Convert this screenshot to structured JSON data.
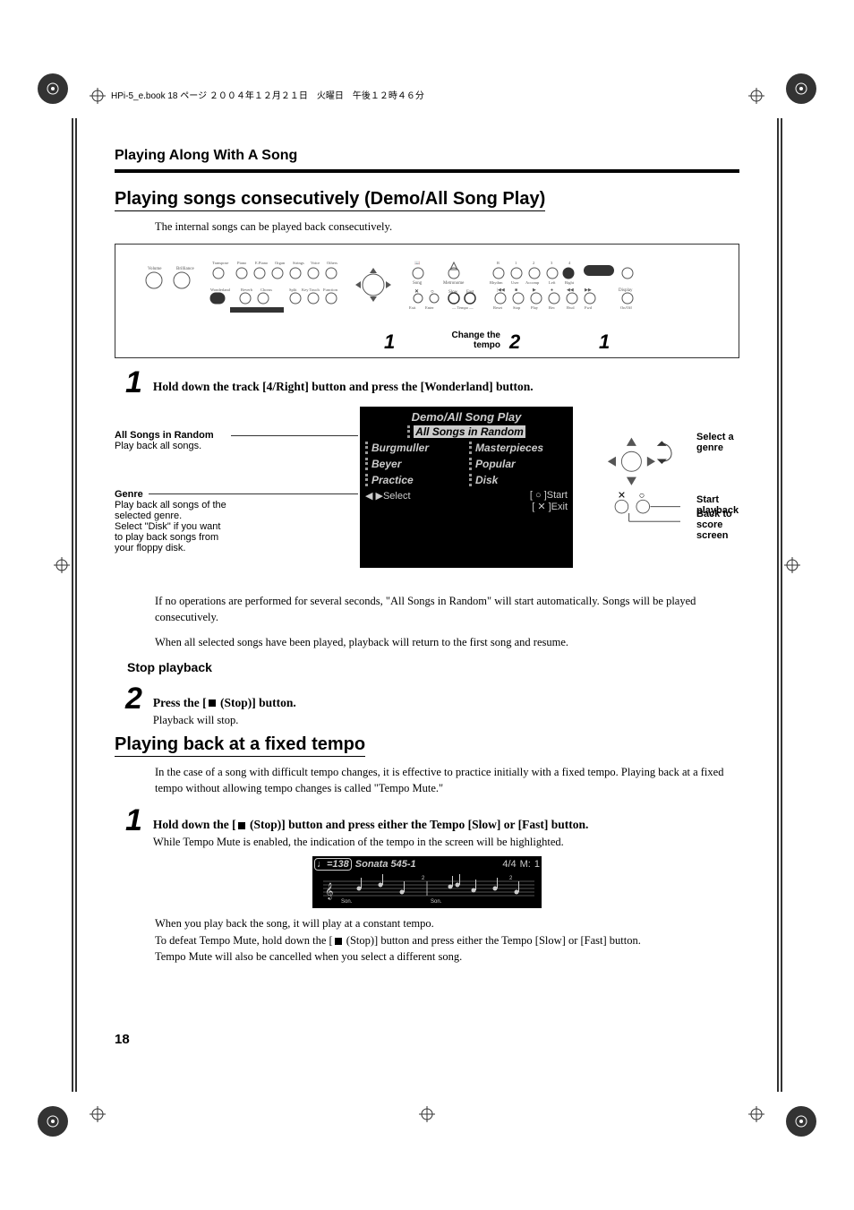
{
  "header_note": "HPi-5_e.book  18 ページ  ２００４年１２月２１日　火曜日　午後１２時４６分",
  "section_top": "Playing Along With A Song",
  "h2a": "Playing songs consecutively (Demo/All Song Play)",
  "intro_a": "The internal songs can be played back consecutively.",
  "panel": {
    "change_tempo": "Change the tempo",
    "num2": "2",
    "num1a": "1",
    "num1b": "1"
  },
  "step1_num": "1",
  "step1_text": "Hold down the track [4/Right] button and press the [Wonderland] button.",
  "lcd": {
    "title": "Demo/All Song Play",
    "all_random": "All Songs in Random",
    "r1a": "Burgmuller",
    "r1b": "Masterpieces",
    "r2a": "Beyer",
    "r2b": "Popular",
    "r3a": "Practice",
    "r3b": "Disk",
    "bl": "◀ ▶Select",
    "br1": "[ ○ ]Start",
    "br2": "[ ✕ ]Exit"
  },
  "ann": {
    "all_title": "All Songs in Random",
    "all_body": "Play back all songs.",
    "genre_title": "Genre",
    "genre_body1": "Play back all songs of the selected genre.",
    "genre_body2": "Select \"Disk\" if you want to play back songs from your floppy disk.",
    "select_genre": "Select a genre",
    "start_pb": "Start playback",
    "back_score": "Back to score screen"
  },
  "post1a": "If no operations are performed for several seconds, \"All Songs in Random\" will start automatically. Songs will be played consecutively.",
  "post1b": "When all selected songs have been played, playback will return to the first song and resume.",
  "stop_h": "Stop playback",
  "step2_num": "2",
  "step2_text_a": "Press the [",
  "step2_text_b": " (Stop)] button.",
  "step2_body": "Playback will stop.",
  "h2b": "Playing back at a fixed tempo",
  "intro_b1": "In the case of a song with difficult tempo changes, it is effective to practice initially with a fixed tempo. Playing back at a fixed tempo without allowing tempo changes is called \"Tempo Mute.\"",
  "step3_num": "1",
  "step3_text_a": "Hold down the [",
  "step3_text_b": " (Stop)] button and press either the Tempo [Slow] or [Fast] button.",
  "step3_body": "While Tempo Mute is enabled, the indication of the tempo in the screen will be highlighted.",
  "mini": {
    "tempo": "♩=138",
    "title": "Sonata 545-1",
    "sig": "4/4",
    "m": "M:",
    "mval": "1"
  },
  "post3a": "When you play back the song, it will play at a constant tempo.",
  "post3b_a": "To defeat Tempo Mute, hold down the [",
  "post3b_b": " (Stop)] button and press either the Tempo [Slow] or [Fast] button.",
  "post3c": "Tempo Mute will also be cancelled when you select a different song.",
  "page_num": "18"
}
